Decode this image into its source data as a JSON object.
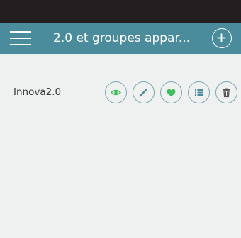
{
  "header": {
    "title": "2.0 et groupes appar...",
    "menu_icon": "hamburger-menu-icon",
    "add_icon": "plus-circle-icon"
  },
  "list": {
    "items": [
      {
        "label": "Innova2.0",
        "actions": [
          "eye-icon",
          "pencil-icon",
          "heart-icon",
          "list-icon",
          "trash-icon"
        ]
      }
    ]
  },
  "colors": {
    "header_bg": "#4a8c9c",
    "status_bar_bg": "#231f20",
    "page_bg": "#eff0f0",
    "accent_green": "#3cbf5a",
    "button_border": "#7da7b1"
  }
}
